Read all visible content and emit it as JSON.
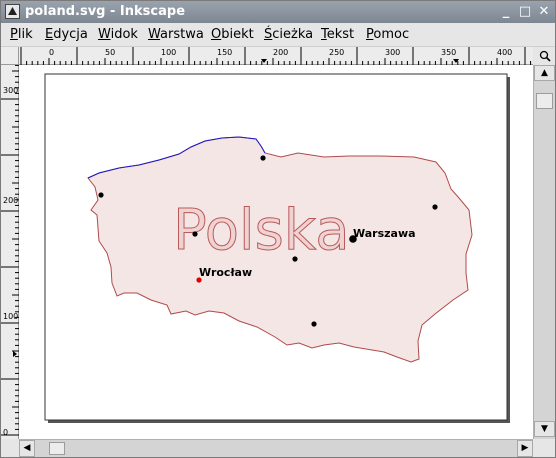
{
  "window": {
    "title": "poland.svg - Inkscape",
    "controls": {
      "minimize": "_",
      "maximize": "□",
      "close": "✕"
    }
  },
  "menu": {
    "items": [
      {
        "label": "Plik"
      },
      {
        "label": "Edycja"
      },
      {
        "label": "Widok"
      },
      {
        "label": "Warstwa"
      },
      {
        "label": "Obiekt"
      },
      {
        "label": "Ścieżka"
      },
      {
        "label": "Tekst"
      },
      {
        "label": "Pomoc"
      }
    ]
  },
  "rulers": {
    "horizontal_ticks": [
      "0",
      "50",
      "100",
      "150",
      "200",
      "250",
      "300",
      "350",
      "400"
    ],
    "vertical_ticks": [
      "300",
      "200",
      "100",
      "0"
    ]
  },
  "drawing": {
    "main_label": "Polska",
    "cities": [
      {
        "name": "Warszawa",
        "color": "#000000"
      },
      {
        "name": "Wrocław",
        "color": "#e00000"
      }
    ],
    "colors": {
      "fill": "#f5e6e6",
      "border": "#b04a4a",
      "coast": "#1a1acc",
      "text_fill": "#efd2d2",
      "text_stroke": "#b85a5a"
    }
  },
  "icons": {
    "zoom": "magnifier-icon",
    "scroll_up": "arrow-up-icon",
    "scroll_down": "arrow-down-icon",
    "scroll_left": "arrow-left-icon",
    "scroll_right": "arrow-right-icon"
  }
}
